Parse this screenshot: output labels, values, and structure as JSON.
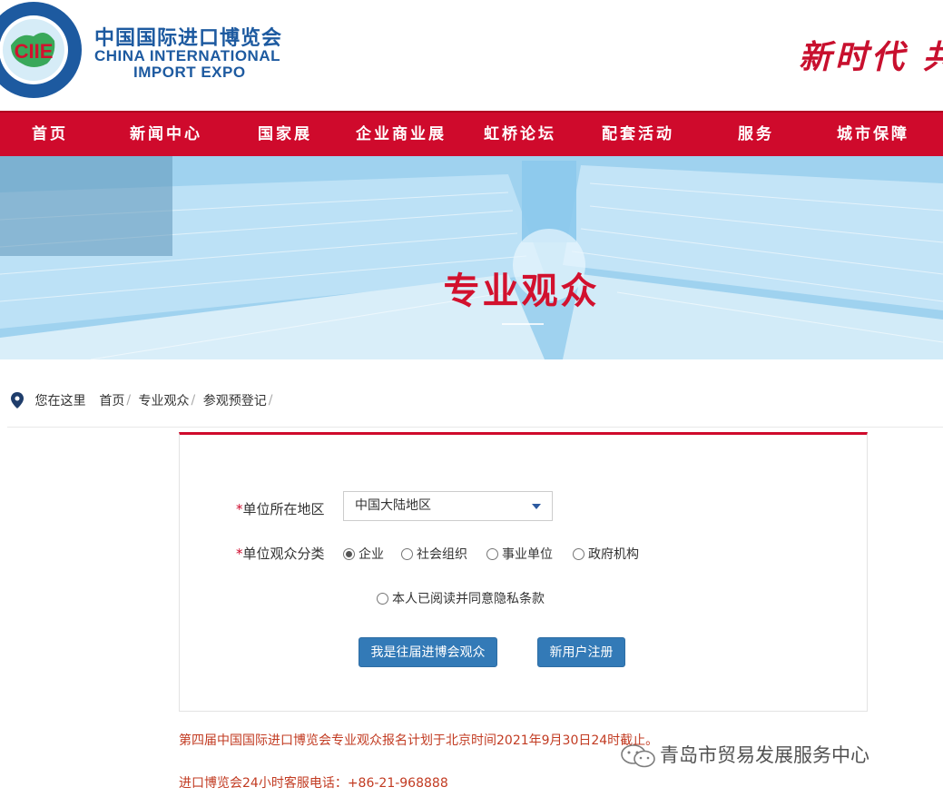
{
  "header": {
    "logo_mark": "CIIE",
    "logo_cn": "中国国际进口博览会",
    "logo_en_line1": "CHINA INTERNATIONAL",
    "logo_en_line2": "IMPORT EXPO",
    "slogan": "新时代 共"
  },
  "nav": {
    "items": [
      "首页",
      "新闻中心",
      "国家展",
      "企业商业展",
      "虹桥论坛",
      "配套活动",
      "服务",
      "城市保障"
    ]
  },
  "banner": {
    "title": "专业观众"
  },
  "breadcrumb": {
    "prefix": "您在这里",
    "items": [
      "首页",
      "专业观众",
      "参观预登记"
    ],
    "separator": "/"
  },
  "form": {
    "region_label": "单位所在地区",
    "region_required": "*",
    "region_value": "中国大陆地区",
    "category_label": "单位观众分类",
    "category_required": "*",
    "category_options": [
      "企业",
      "社会组织",
      "事业单位",
      "政府机构"
    ],
    "category_selected": "企业",
    "privacy_label": "本人已阅读并同意隐私条款",
    "returning_button": "我是往届进博会观众",
    "register_button": "新用户注册"
  },
  "notes": {
    "deadline": "第四届中国国际进口博览会专业观众报名计划于北京时间2021年9月30日24时截止。",
    "hotline": "进口博览会24小时客服电话：+86-21-968888"
  },
  "watermark": "青岛市贸易发展服务中心",
  "colors": {
    "brand_red": "#cf0a2c",
    "brand_blue": "#1d5aa0",
    "button_blue": "#337ab7",
    "note_red": "#c23b22"
  }
}
